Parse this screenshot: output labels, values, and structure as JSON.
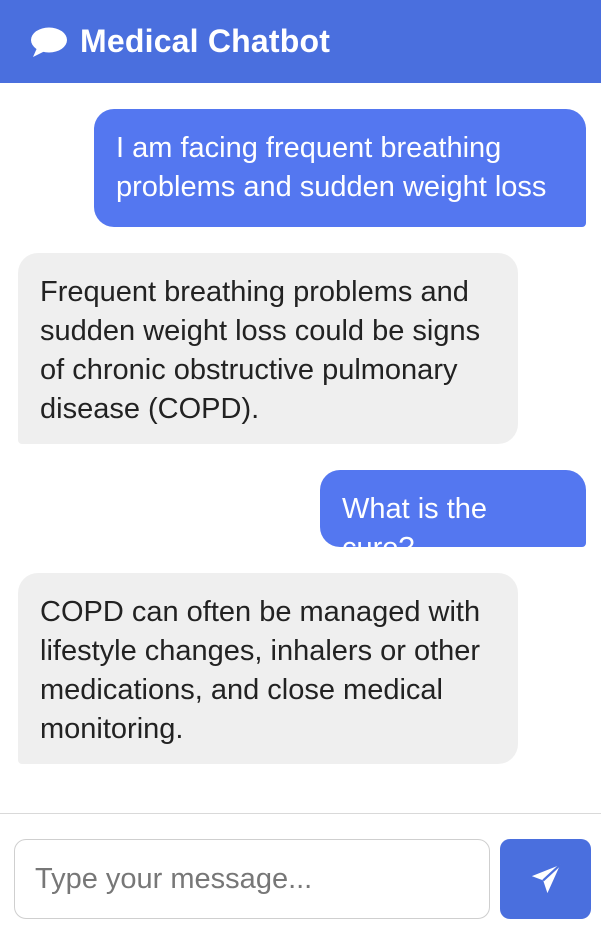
{
  "header": {
    "title": "Medical Chatbot",
    "icon": "chat-bubble-icon",
    "color": "#4a6fde"
  },
  "messages": [
    {
      "role": "user",
      "text": "I am facing frequent breathing problems and sudden weight loss"
    },
    {
      "role": "bot",
      "text": "Frequent breathing problems and sudden weight loss could be signs of chronic obstructive pulmonary disease (COPD)."
    },
    {
      "role": "user",
      "text": "What is the cure?"
    },
    {
      "role": "bot",
      "text": "COPD can often be managed with lifestyle changes, inhalers or other medications, and close medical monitoring."
    }
  ],
  "composer": {
    "placeholder": "Type your message...",
    "value": "",
    "send_icon": "send-icon"
  },
  "colors": {
    "user_bubble": "#5477f0",
    "bot_bubble": "#efefef",
    "accent": "#4a6fde"
  }
}
